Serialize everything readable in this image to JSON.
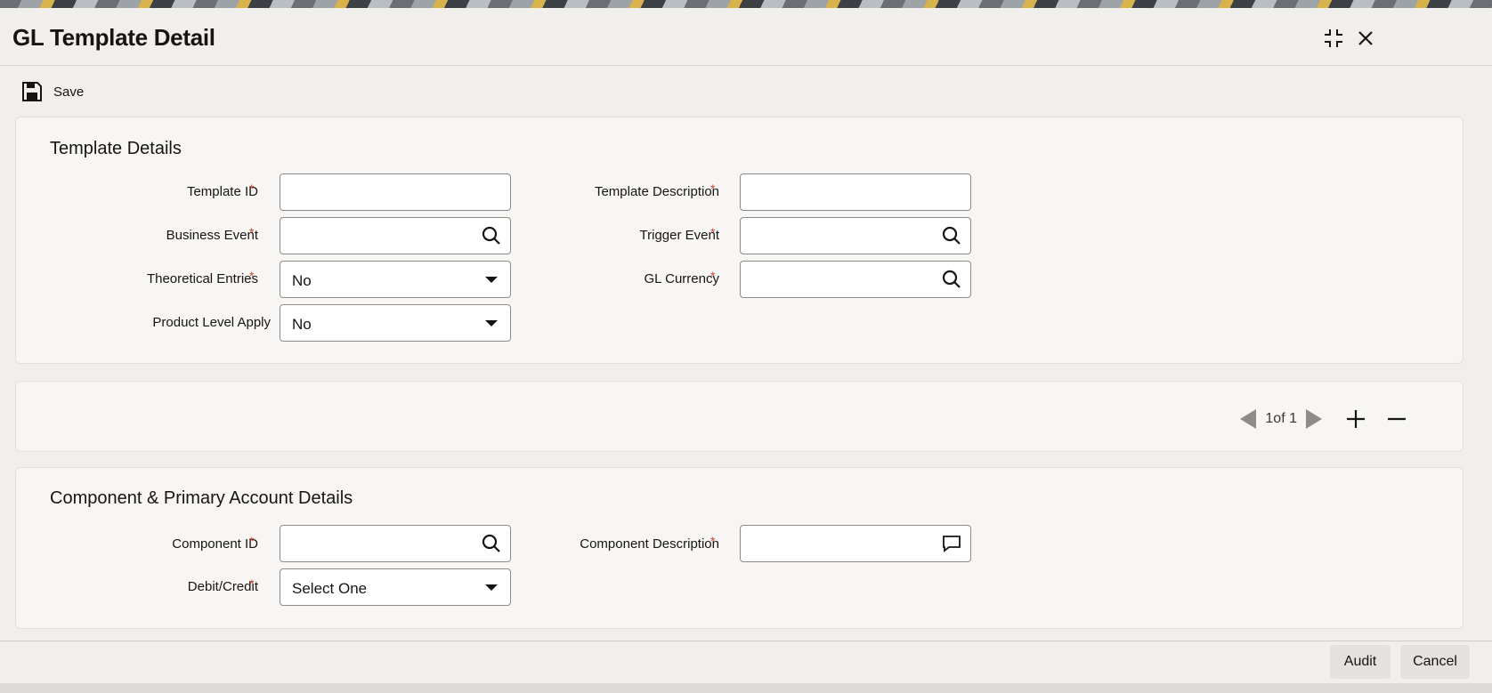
{
  "window": {
    "title": "GL Template Detail",
    "maximize_icon": "maximize-icon",
    "close_icon": "close-icon"
  },
  "toolbar": {
    "save_label": "Save",
    "save_icon": "floppy-disk-icon"
  },
  "template_details": {
    "heading": "Template Details",
    "template_id": {
      "label": "Template ID",
      "required": "*",
      "value": ""
    },
    "template_description": {
      "label": "Template Description",
      "required": "*",
      "value": ""
    },
    "business_event": {
      "label": "Business Event",
      "required": "*",
      "value": ""
    },
    "trigger_event": {
      "label": "Trigger Event",
      "required": "*",
      "value": ""
    },
    "theoretical_entries": {
      "label": "Theoretical Entries",
      "required": "*",
      "value": "No"
    },
    "gl_currency": {
      "label": "GL Currency",
      "required": "*",
      "value": ""
    },
    "product_level_apply": {
      "label": "Product Level Apply",
      "value": "No"
    }
  },
  "pager": {
    "text": "1of 1"
  },
  "component_details": {
    "heading": "Component & Primary Account Details",
    "component_id": {
      "label": "Component ID",
      "required": "*",
      "value": ""
    },
    "component_description": {
      "label": "Component Description",
      "required": "*",
      "value": ""
    },
    "debit_credit": {
      "label": "Debit/Credit",
      "required": "*",
      "value": "Select One"
    }
  },
  "footer": {
    "audit_label": "Audit",
    "cancel_label": "Cancel"
  },
  "colors": {
    "required": "#c74634",
    "panel": "#f7f6f4",
    "background": "#f1efec"
  }
}
